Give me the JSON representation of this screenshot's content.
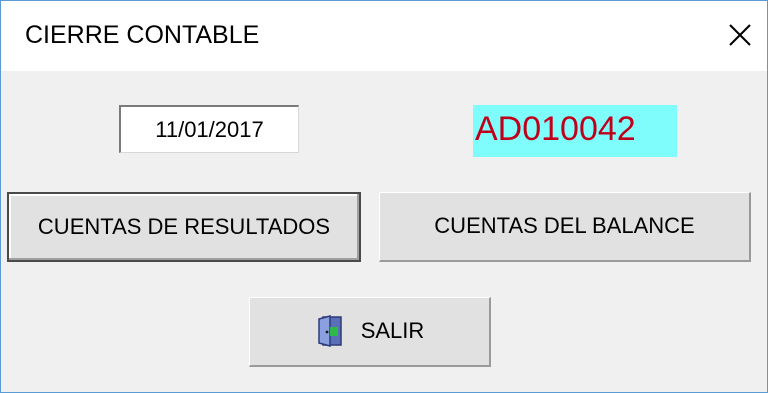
{
  "window": {
    "title": "CIERRE CONTABLE",
    "close_icon": "close-icon"
  },
  "form": {
    "date_value": "11/01/2017",
    "code": "AD010042",
    "code_bg": "#7ffcfc",
    "code_color": "#c0001a"
  },
  "buttons": {
    "resultados_label": "CUENTAS DE RESULTADOS",
    "balance_label": "CUENTAS DEL BALANCE",
    "salir_label": "SALIR",
    "salir_icon": "exit-door-icon"
  }
}
